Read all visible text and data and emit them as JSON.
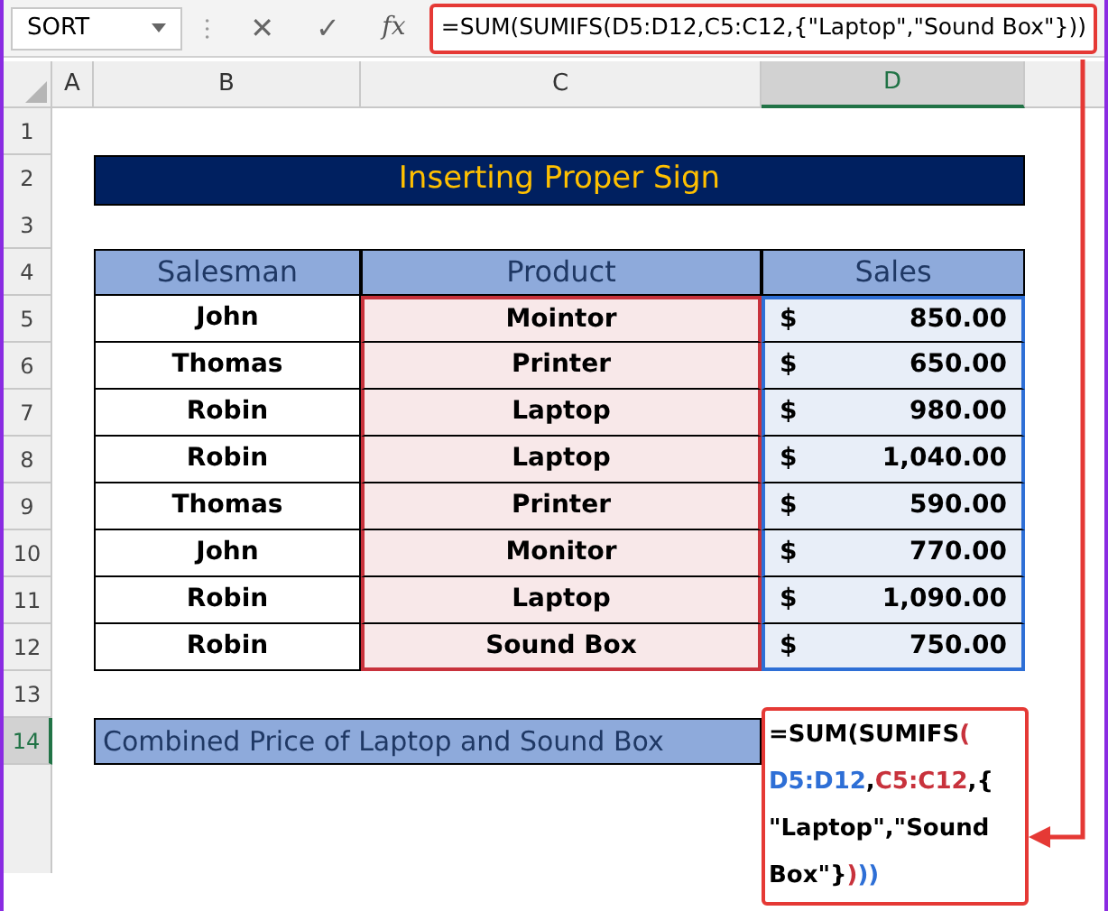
{
  "formula_bar": {
    "name_box": "SORT",
    "cancel": "✕",
    "enter": "✓",
    "fx": "fx",
    "formula": "=SUM(SUMIFS(D5:D12,C5:C12,{\"Laptop\",\"Sound Box\"}))"
  },
  "column_headers": [
    {
      "label": "A",
      "selected": false
    },
    {
      "label": "B",
      "selected": false
    },
    {
      "label": "C",
      "selected": false
    },
    {
      "label": "D",
      "selected": true
    }
  ],
  "row_numbers": [
    {
      "label": "1",
      "selected": false
    },
    {
      "label": "2",
      "selected": false
    },
    {
      "label": "3",
      "selected": false
    },
    {
      "label": "4",
      "selected": false
    },
    {
      "label": "5",
      "selected": false
    },
    {
      "label": "6",
      "selected": false
    },
    {
      "label": "7",
      "selected": false
    },
    {
      "label": "8",
      "selected": false
    },
    {
      "label": "9",
      "selected": false
    },
    {
      "label": "10",
      "selected": false
    },
    {
      "label": "11",
      "selected": false
    },
    {
      "label": "12",
      "selected": false
    },
    {
      "label": "13",
      "selected": false
    },
    {
      "label": "14",
      "selected": true
    }
  ],
  "title": "Inserting Proper Sign",
  "table": {
    "columns": [
      {
        "label": "Salesman"
      },
      {
        "label": "Product",
        "color": "#c8323c"
      },
      {
        "label": "Sales",
        "color": "#2e6fd6"
      }
    ],
    "rows": [
      {
        "salesman": "John",
        "product": "Mointor",
        "currency": "$",
        "sales": "850.00"
      },
      {
        "salesman": "Thomas",
        "product": "Printer",
        "currency": "$",
        "sales": "650.00"
      },
      {
        "salesman": "Robin",
        "product": "Laptop",
        "currency": "$",
        "sales": "980.00"
      },
      {
        "salesman": "Robin",
        "product": "Laptop",
        "currency": "$",
        "sales": "1,040.00"
      },
      {
        "salesman": "Thomas",
        "product": "Printer",
        "currency": "$",
        "sales": "590.00"
      },
      {
        "salesman": "John",
        "product": "Monitor",
        "currency": "$",
        "sales": "770.00"
      },
      {
        "salesman": "Robin",
        "product": "Laptop",
        "currency": "$",
        "sales": "1,090.00"
      },
      {
        "salesman": "Robin",
        "product": "Sound Box",
        "currency": "$",
        "sales": "750.00"
      }
    ]
  },
  "result_label": "Combined Price of Laptop and Sound Box",
  "formula_cell": {
    "lines": [
      [
        {
          "text": "=SUM(SUMIFS",
          "color": "#000000"
        },
        {
          "text": "(",
          "color": "#c8323c"
        }
      ],
      [
        {
          "text": "D5:D12",
          "color": "#2e6fd6"
        },
        {
          "text": ",",
          "color": "#000000"
        },
        {
          "text": "C5:C12",
          "color": "#c8323c"
        },
        {
          "text": ",{",
          "color": "#000000"
        }
      ],
      [
        {
          "text": "\"Laptop\",\"Sound",
          "color": "#000000"
        }
      ],
      [
        {
          "text": "Box\"}",
          "color": "#000000"
        },
        {
          "text": ")",
          "color": "#c8323c"
        },
        {
          "text": "))",
          "color": "#2e6fd6"
        }
      ]
    ]
  }
}
